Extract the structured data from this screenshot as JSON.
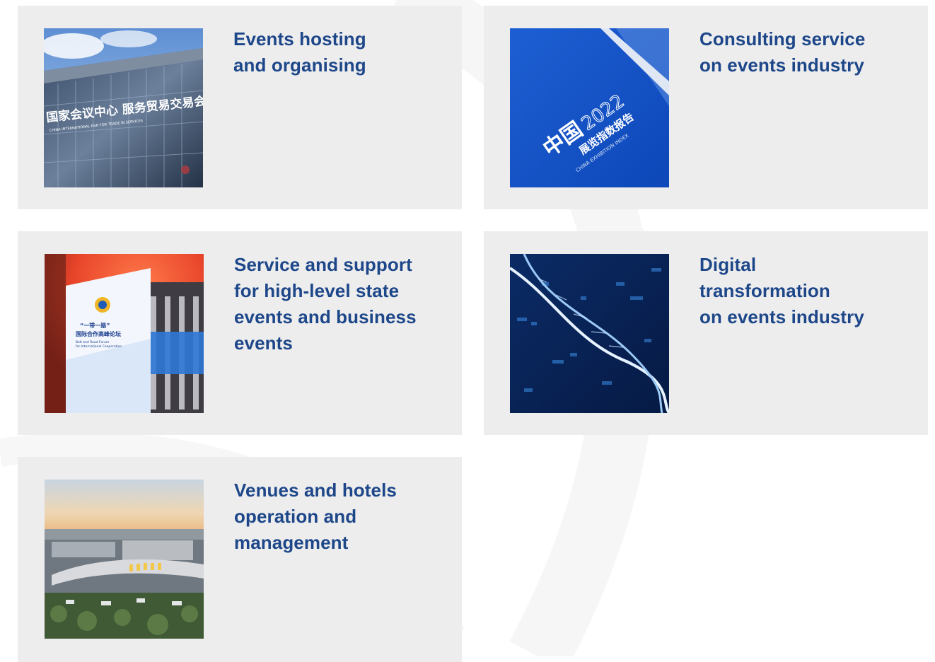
{
  "services": [
    {
      "title": "Events hosting\nand organising",
      "image": "convention-center-facade"
    },
    {
      "title": "Consulting service\non events industry",
      "image": "exhibition-index-report-cover"
    },
    {
      "title": "Service and support\nfor high-level state\nevents and business\nevents",
      "image": "forum-venue-banner"
    },
    {
      "title": "Digital\ntransformation\non events industry",
      "image": "dna-helix-digital"
    },
    {
      "title": "Venues and hotels\noperation and\nmanagement",
      "image": "venue-aerial-view"
    }
  ],
  "image_text": {
    "facade_sign": "国家会议中心 服务贸易交易会",
    "facade_subsign": "CHINA INTERNATIONAL FAIR FOR TRADE IN SERVICES",
    "report_logo": "中国",
    "report_year": "2022",
    "report_title": "展览指数报告",
    "report_subtitle": "CHINA EXHIBITION INDEX",
    "forum_banner_line1": "“一带一路”",
    "forum_banner_line2": "国际合作高峰论坛",
    "forum_banner_line3": "Belt and Road Forum",
    "forum_banner_line4": "for International Cooperation"
  },
  "colors": {
    "card_bg": "#ededee",
    "title": "#1d4789",
    "page_bg": "#ffffff"
  }
}
